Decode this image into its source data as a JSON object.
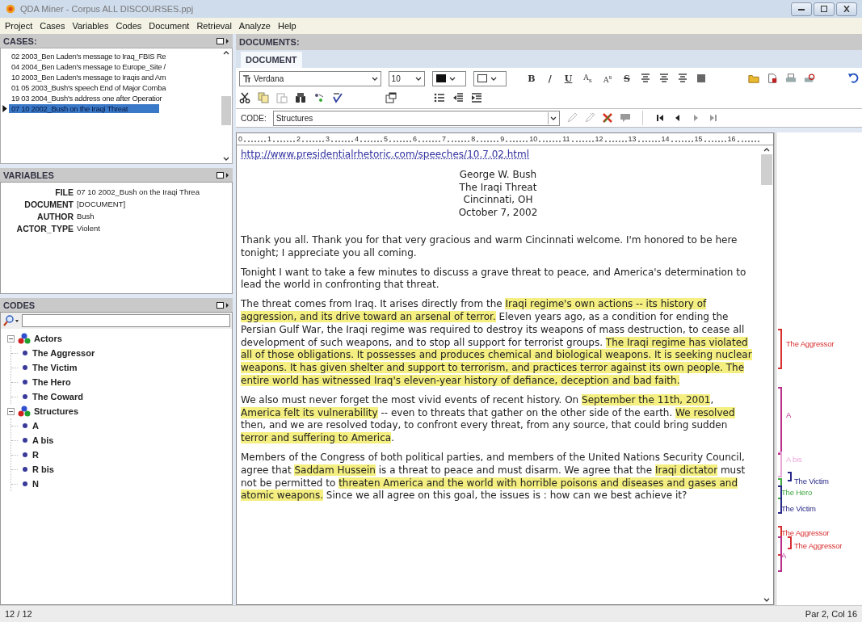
{
  "window": {
    "title": "QDA Miner - Corpus ALL DISCOURSES.ppj"
  },
  "menu": [
    "Project",
    "Cases",
    "Variables",
    "Codes",
    "Document",
    "Retrieval",
    "Analyze",
    "Help"
  ],
  "cases": {
    "title": "CASES:",
    "items": [
      {
        "label": "02 2003_Ben Laden's message to Iraq_FBIS Re",
        "selected": false
      },
      {
        "label": "04 2004_Ben Laden's message to Europe_Site /",
        "selected": false
      },
      {
        "label": "10 2003_Ben Laden's message to Iraqis and Am",
        "selected": false
      },
      {
        "label": "01 05 2003_Bush's speech End of Major Comba",
        "selected": false
      },
      {
        "label": "19 03 2004_Bush's address one after Operatior",
        "selected": false
      },
      {
        "label": "07 10 2002_Bush on the Iraqi Threat",
        "selected": true
      }
    ]
  },
  "variables": {
    "title": "VARIABLES",
    "rows": [
      {
        "name": "FILE",
        "value": "07 10 2002_Bush on the Iraqi Threa"
      },
      {
        "name": "DOCUMENT",
        "value": "[DOCUMENT]"
      },
      {
        "name": "AUTHOR",
        "value": "Bush"
      },
      {
        "name": "ACTOR_TYPE",
        "value": "Violent"
      }
    ]
  },
  "codes": {
    "title": "CODES",
    "tree": [
      {
        "label": "Actors",
        "expanded": true,
        "children": [
          {
            "label": "The Aggressor"
          },
          {
            "label": "The Victim"
          },
          {
            "label": "The Hero"
          },
          {
            "label": "The Coward"
          }
        ]
      },
      {
        "label": "Structures",
        "expanded": true,
        "children": [
          {
            "label": "A"
          },
          {
            "label": "A bis"
          },
          {
            "label": "R"
          },
          {
            "label": "R bis"
          },
          {
            "label": "N"
          }
        ]
      }
    ]
  },
  "documents": {
    "title": "DOCUMENTS:",
    "tabs": [
      {
        "label": "DOCUMENT",
        "selected": true
      }
    ]
  },
  "toolbar": {
    "font": "Verdana",
    "size": "10",
    "format_buttons": [
      {
        "label": "B",
        "kind": "bold"
      },
      {
        "label": "/",
        "kind": "italic"
      },
      {
        "label": "U",
        "kind": "underline"
      },
      {
        "label": "A$_{s}$",
        "kind": "subscript"
      },
      {
        "label": "A$^{s}$",
        "kind": "superscript"
      },
      {
        "label": "S",
        "kind": "strike"
      }
    ]
  },
  "code_bar": {
    "label": "CODE:",
    "value": "Structures"
  },
  "ruler": [
    "0",
    "1",
    "2",
    "3",
    "4",
    "5",
    "6",
    "7",
    "8",
    "9",
    "10",
    "11",
    "12",
    "13",
    "14",
    "15",
    "16"
  ],
  "document": {
    "url": "http://www.presidentialrhetoric.com/speeches/10.7.02.html",
    "heading": [
      "George W. Bush",
      "The Iraqi Threat",
      "Cincinnati, OH",
      "October 7, 2002"
    ],
    "paragraphs": [
      {
        "segments": [
          {
            "text": "Thank you all. Thank you for that very gracious and warm Cincinnati welcome. I'm honored to be here tonight; I appreciate you all coming.",
            "highlighted": false
          }
        ]
      },
      {
        "segments": [
          {
            "text": "Tonight I want to take a few minutes to discuss a grave threat to peace, and America's determination to lead the world in confronting that threat.",
            "highlighted": false
          }
        ]
      },
      {
        "segments": [
          {
            "text": "The threat comes from Iraq. It arises directly from the ",
            "highlighted": false
          },
          {
            "text": "Iraqi regime's own actions -- its history of aggression, and its drive toward an arsenal of terror.",
            "highlighted": true
          },
          {
            "text": " Eleven years ago, as a condition for ending the Persian Gulf War, the Iraqi regime was required to destroy its weapons of mass destruction, to cease all development of such weapons, and to stop all support for terrorist groups. ",
            "highlighted": false
          },
          {
            "text": "The Iraqi regime has violated all of those obligations. It possesses and produces chemical and biological weapons. It is seeking nuclear weapons. It has given shelter and support to terrorism, and practices terror against its own people. The entire world has witnessed Iraq's eleven-year history of defiance, deception and bad faith.",
            "highlighted": true
          }
        ]
      },
      {
        "segments": [
          {
            "text": "We also must never forget the most vivid events of recent history. On ",
            "highlighted": false
          },
          {
            "text": "September the 11th, 2001",
            "highlighted": true
          },
          {
            "text": ", ",
            "highlighted": false
          },
          {
            "text": "America felt its vulnerability",
            "highlighted": true
          },
          {
            "text": " -- even to threats that gather on the other side of the earth. ",
            "highlighted": false
          },
          {
            "text": "We resolved",
            "highlighted": true
          },
          {
            "text": " then, and we are resolved today, to confront every threat, from any source, that could bring sudden ",
            "highlighted": false
          },
          {
            "text": "terror and suffering to America",
            "highlighted": true
          },
          {
            "text": ".",
            "highlighted": false
          }
        ]
      },
      {
        "segments": [
          {
            "text": "Members of the Congress of both political parties, and members of the United Nations Security Council, agree that ",
            "highlighted": false
          },
          {
            "text": "Saddam Hussein",
            "highlighted": true
          },
          {
            "text": " is a threat to peace and must disarm. We agree that the ",
            "highlighted": false
          },
          {
            "text": "Iraqi dictator",
            "highlighted": true
          },
          {
            "text": " must not be permitted to ",
            "highlighted": false
          },
          {
            "text": "threaten America and the world with horrible poisons and diseases and gases and atomic weapons.",
            "highlighted": true
          },
          {
            "text": " Since we all agree on this goal, the issues is : how can we best achieve it?",
            "highlighted": false
          }
        ]
      }
    ]
  },
  "margin_codes": [
    {
      "label": "The Aggressor",
      "color": "#d83030"
    },
    {
      "label": "A",
      "color": "#b8308c"
    },
    {
      "label": "A bis",
      "color": "#e8a8d8"
    },
    {
      "label": "The Victim",
      "color": "#282888"
    },
    {
      "label": "The Hero",
      "color": "#40a840"
    },
    {
      "label": "The Victim",
      "color": "#282888"
    },
    {
      "label": "The Aggressor",
      "color": "#d83030"
    },
    {
      "label": "The Aggressor",
      "color": "#d83030"
    },
    {
      "label": "A",
      "color": "#b8308c"
    }
  ],
  "status_bar": {
    "left": "12 / 12",
    "right": "Par 2, Col 16"
  }
}
